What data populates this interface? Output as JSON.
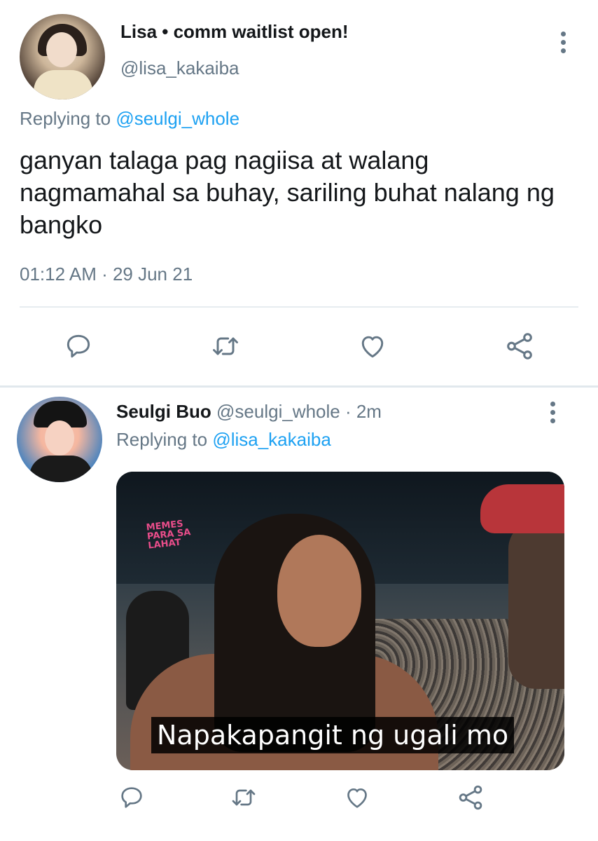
{
  "main_tweet": {
    "display_name": "Lisa • comm waitlist open!",
    "handle": "@lisa_kakaiba",
    "replying_label": "Replying to",
    "replying_mention": "@seulgi_whole",
    "text": "ganyan talaga pag nagiisa at walang nagmamahal sa buhay, sariling buhat nalang ng bangko",
    "timestamp": "01:12 AM · 29 Jun 21",
    "actions": [
      "reply-icon",
      "retweet-icon",
      "like-icon",
      "share-icon"
    ]
  },
  "reply_tweet": {
    "display_name": "Seulgi Buo",
    "handle": "@seulgi_whole",
    "time": "· 2m",
    "replying_label": "Replying to",
    "replying_mention": "@lisa_kakaiba",
    "media": {
      "watermark": "MEMES PARA SA LAHAT",
      "subtitle": "Napakapangit ng ugali mo"
    },
    "actions": [
      "reply-icon",
      "retweet-icon",
      "like-icon",
      "share-icon"
    ]
  },
  "colors": {
    "text_primary": "#14171a",
    "text_secondary": "#657786",
    "link": "#1da1f2",
    "divider": "#e6ecf0"
  }
}
